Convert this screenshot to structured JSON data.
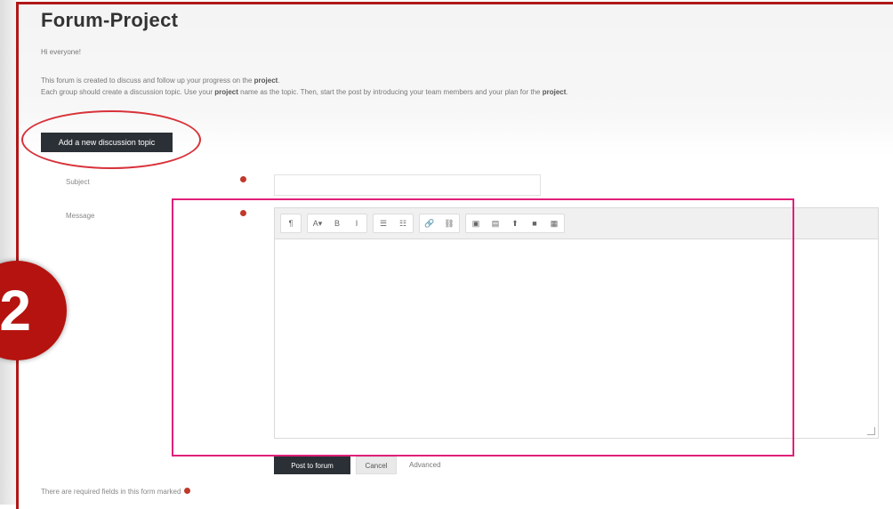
{
  "page": {
    "title": "Forum-Project",
    "greeting": "Hi everyone!",
    "intro_line1_a": "This forum is created to discuss and follow up your progress on the ",
    "intro_line1_b": "project",
    "intro_line2_a": "Each group should create a discussion topic. Use your ",
    "intro_line2_b": "project",
    "intro_line2_c": " name as the topic. Then, start the post by introducing your team members and your plan for the ",
    "intro_line2_d": "project"
  },
  "step_badge": "2",
  "add_topic_button": "Add a new discussion topic",
  "form": {
    "subject_label": "Subject",
    "subject_value": "",
    "message_label": "Message",
    "message_value": ""
  },
  "toolbar": {
    "groups": [
      [
        "¶"
      ],
      [
        "A▾",
        "B",
        "I"
      ],
      [
        "☰",
        "☷"
      ],
      [
        "🔗",
        "⛓"
      ],
      [
        "▣",
        "▤",
        "⬆",
        "■",
        "▦"
      ]
    ],
    "icon_names": [
      "paragraph-icon",
      "font-size-icon",
      "bold-icon",
      "italic-icon",
      "unordered-list-icon",
      "ordered-list-icon",
      "link-icon",
      "unlink-icon",
      "image-icon",
      "media-icon",
      "upload-icon",
      "video-icon",
      "copy-icon"
    ]
  },
  "buttons": {
    "post": "Post to forum",
    "cancel": "Cancel",
    "advanced": "Advanced"
  },
  "footnote": "There are required fields in this form marked",
  "colors": {
    "frame_red": "#b01818",
    "badge_red": "#b5130f",
    "annot_ellipse": "#d8323a",
    "annot_rect": "#e0207a",
    "button_dark": "#2b3036",
    "required": "#c0392b"
  }
}
